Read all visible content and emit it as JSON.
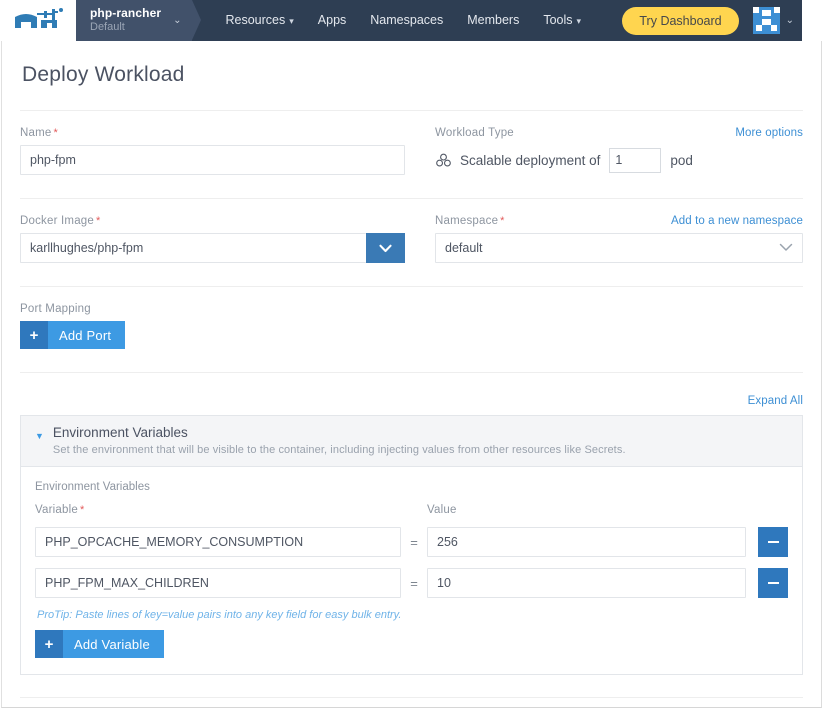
{
  "navbar": {
    "logo_icon": "rancher-cow-logo",
    "project": {
      "name": "php-rancher",
      "scope": "Default",
      "caret": "⌄"
    },
    "links": [
      {
        "label": "Resources",
        "has_caret": true
      },
      {
        "label": "Apps",
        "has_caret": false
      },
      {
        "label": "Namespaces",
        "has_caret": false
      },
      {
        "label": "Members",
        "has_caret": false
      },
      {
        "label": "Tools",
        "has_caret": true
      }
    ],
    "try_dashboard_label": "Try Dashboard",
    "avatar_icon": "user-identicon-avatar",
    "avatar_caret": "⌄",
    "colors": {
      "bar": "#2e3e53",
      "project": "#41516a",
      "accent": "#ffd54f"
    }
  },
  "page": {
    "title": "Deploy Workload"
  },
  "name_field": {
    "label": "Name",
    "required_marker": "*",
    "value": "php-fpm",
    "placeholder": ""
  },
  "workload_type": {
    "label": "Workload Type",
    "more_options_label": "More options",
    "icon": "scalable-deployment-icon",
    "text_before": "Scalable deployment of",
    "pod_count": "1",
    "text_after": "pod"
  },
  "docker_image": {
    "label": "Docker Image",
    "required_marker": "*",
    "value": "karllhughes/php-fpm",
    "placeholder": "",
    "dropdown_icon": "chevron-down-icon"
  },
  "namespace": {
    "label": "Namespace",
    "required_marker": "*",
    "add_new_label": "Add to a new namespace",
    "value": "default",
    "options": [
      "default"
    ],
    "dropdown_icon": "chevron-down-icon"
  },
  "port_mapping": {
    "label": "Port Mapping",
    "add_button_label": "Add Port",
    "add_button_icon": "plus-icon"
  },
  "expand_all_label": "Expand All",
  "environment_variables": {
    "accordion_title": "Environment Variables",
    "accordion_description": "Set the environment that will be visible to the container, including injecting values from other resources like Secrets.",
    "accordion_caret_icon": "caret-down-icon",
    "section_caption": "Environment Variables",
    "columns": {
      "variable": "Variable",
      "variable_required": "*",
      "equals": "=",
      "value": "Value"
    },
    "rows": [
      {
        "variable": "PHP_OPCACHE_MEMORY_CONSUMPTION",
        "value": "256",
        "remove_icon": "minus-icon"
      },
      {
        "variable": "PHP_FPM_MAX_CHILDREN",
        "value": "10",
        "remove_icon": "minus-icon"
      }
    ],
    "protip": "ProTip: Paste lines of key=value pairs into any key field for easy bulk entry.",
    "add_button_label": "Add Variable",
    "add_button_icon": "plus-icon"
  }
}
